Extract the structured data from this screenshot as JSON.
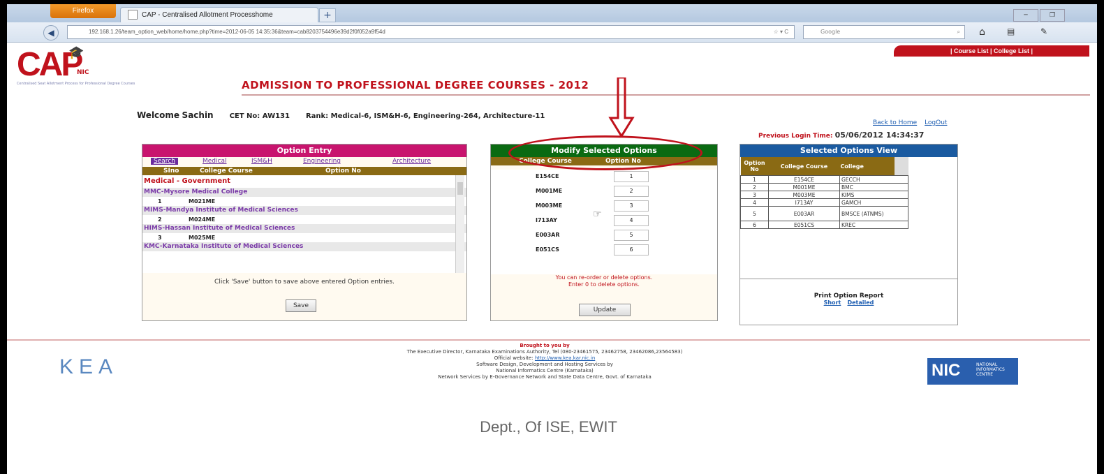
{
  "browser": {
    "menu_button": "Firefox",
    "tab_title": "CAP - Centralised Allotment Processhome",
    "new_tab": "+",
    "url": "192.168.1.26/team_option_web/home/home.php?time=2012-06-05 14:35:36&team=cab8203754496e39d2f0f052a9f54d",
    "search_placeholder": "Google"
  },
  "site": {
    "logo_text": "CAP",
    "logo_sub": "NIC",
    "logo_tagline": "Centralised Seat Allotment Process for Professional Degree Courses",
    "top_nav": "| Course List | College List |",
    "page_title": "ADMISSION TO PROFESSIONAL DEGREE COURSES - 2012",
    "welcome_label": "Welcome",
    "user_name": "Sachin",
    "cet_label": "CET No:",
    "cet_no": "AW131",
    "rank_label": "Rank:",
    "rank_value": "Medical-6, ISM&H-6, Engineering-264, Architecture-11",
    "back_home": "Back to Home",
    "logout": "LogOut",
    "last_login_label": "Previous Login Time:",
    "last_login_value": "05/06/2012 14:34:37"
  },
  "option_entry": {
    "title": "Option Entry",
    "tabs": [
      "Search",
      "Medical",
      "ISM&H",
      "Engineering",
      "Architecture"
    ],
    "columns": [
      "SIno",
      "College Course",
      "Option No"
    ],
    "group": "Medical - Government",
    "colleges": [
      {
        "name": "MMC-Mysore Medical College",
        "sno": "1",
        "code": "M021ME"
      },
      {
        "name": "MIMS-Mandya Institute of Medical Sciences",
        "sno": "2",
        "code": "M024ME"
      },
      {
        "name": "HIMS-Hassan Institute of Medical Sciences",
        "sno": "3",
        "code": "M025ME"
      },
      {
        "name": "KMC-Karnataka Institute of Medical Sciences",
        "sno": "",
        "code": ""
      }
    ],
    "note": "Click 'Save' button to save above entered Option entries.",
    "save": "Save"
  },
  "modify": {
    "title": "Modify Selected Options",
    "columns": [
      "College Course",
      "Option No"
    ],
    "rows": [
      {
        "code": "E154CE",
        "opt": "1"
      },
      {
        "code": "M001ME",
        "opt": "2"
      },
      {
        "code": "M003ME",
        "opt": "3"
      },
      {
        "code": "I713AY",
        "opt": "4"
      },
      {
        "code": "E003AR",
        "opt": "5"
      },
      {
        "code": "E051CS",
        "opt": "6"
      }
    ],
    "note1": "You can re-order or delete options.",
    "note2": "Enter 0 to delete options.",
    "update": "Update"
  },
  "selected": {
    "title": "Selected Options View",
    "columns": [
      "Option No",
      "College Course",
      "College"
    ],
    "rows": [
      {
        "no": "1",
        "course": "E154CE",
        "college": "GECCH"
      },
      {
        "no": "2",
        "course": "M001ME",
        "college": "BMC"
      },
      {
        "no": "3",
        "course": "M003ME",
        "college": "KIMS"
      },
      {
        "no": "4",
        "course": "I713AY",
        "college": "GAMCH"
      },
      {
        "no": "5",
        "course": "E003AR",
        "college": "BMSCE (ATNMS)"
      },
      {
        "no": "6",
        "course": "E051CS",
        "college": "KREC"
      }
    ],
    "report_title": "Print Option Report",
    "short": "Short",
    "detailed": "Detailed"
  },
  "footer": {
    "brought": "Brought to you by",
    "line1": "The Executive Director, Karnataka Examinations Authority, Tel (080-23461575, 23462758, 23462086,23564583)",
    "website_label": "Official website:",
    "website": "http://www.kea.kar.nic.in",
    "line3": "Software Design, Development and Hosting Services by",
    "line4": "National Informatics Centre (Karnataka)",
    "line5": "Network Services by E-Governance Network and State Data Centre, Govt. of Karnataka",
    "kea_logo": "KEA",
    "nic_logo": "NIC",
    "nic_text": "NATIONAL INFORMATICS CENTRE"
  },
  "slide_footer": "Dept., Of ISE, EWIT"
}
